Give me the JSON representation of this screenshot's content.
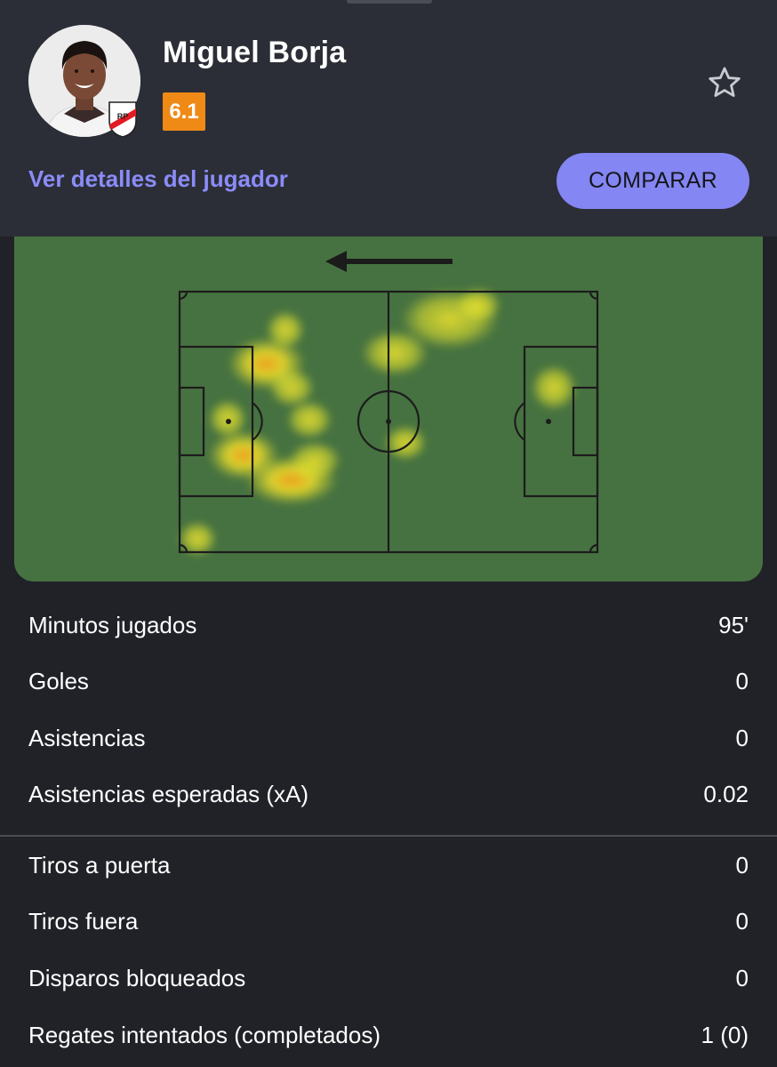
{
  "player": {
    "name": "Miguel Borja",
    "rating": "6.1",
    "rating_color": "#ef8a16",
    "club_badge_icon": "river-plate-crest",
    "favorite_icon": "star-outline-icon"
  },
  "actions": {
    "details_link": "Ver detalles del jugador",
    "compare_button": "COMPARAR",
    "accent_color": "#8486f3"
  },
  "heatmap": {
    "attack_direction": "left",
    "pitch_color": "#467241"
  },
  "stats_group_1": [
    {
      "label": "Minutos jugados",
      "value": "95'"
    },
    {
      "label": "Goles",
      "value": "0"
    },
    {
      "label": "Asistencias",
      "value": "0"
    },
    {
      "label": "Asistencias esperadas (xA)",
      "value": "0.02"
    }
  ],
  "stats_group_2": [
    {
      "label": "Tiros a puerta",
      "value": "0"
    },
    {
      "label": "Tiros fuera",
      "value": "0"
    },
    {
      "label": "Disparos bloqueados",
      "value": "0"
    },
    {
      "label": "Regates intentados (completados)",
      "value": "1 (0)"
    }
  ]
}
